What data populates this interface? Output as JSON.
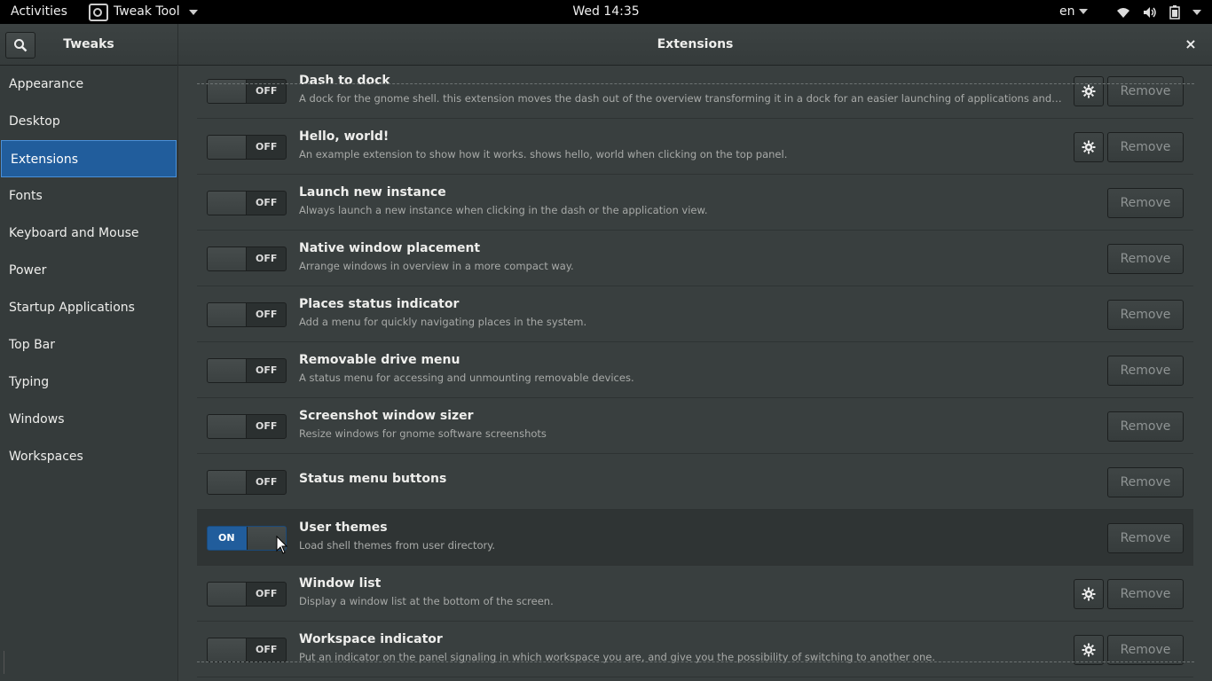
{
  "topbar": {
    "activities": "Activities",
    "app_name": "Tweak Tool",
    "clock": "Wed 14:35",
    "language": "en"
  },
  "header": {
    "sidebar_title": "Tweaks",
    "page_title": "Extensions",
    "close": "×"
  },
  "sidebar": {
    "items": [
      {
        "label": "Appearance"
      },
      {
        "label": "Desktop"
      },
      {
        "label": "Extensions",
        "active": true
      },
      {
        "label": "Fonts"
      },
      {
        "label": "Keyboard and Mouse"
      },
      {
        "label": "Power"
      },
      {
        "label": "Startup Applications"
      },
      {
        "label": "Top Bar"
      },
      {
        "label": "Typing"
      },
      {
        "label": "Windows"
      },
      {
        "label": "Workspaces"
      }
    ]
  },
  "extensions": [
    {
      "name": "Dash to dock",
      "desc": "A dock for the gnome shell. this extension moves the dash out of the overview transforming it in a dock for an easier launching of applications and a faster switching between windows and desktops.",
      "state": "OFF",
      "settings": true,
      "remove": "Remove"
    },
    {
      "name": "Hello, world!",
      "desc": "An example extension to show how it works. shows hello, world when clicking on the top panel.",
      "state": "OFF",
      "settings": true,
      "remove": "Remove"
    },
    {
      "name": "Launch new instance",
      "desc": "Always launch a new instance when clicking in the dash or the application view.",
      "state": "OFF",
      "settings": false,
      "remove": "Remove"
    },
    {
      "name": "Native window placement",
      "desc": "Arrange windows in overview in a more compact way.",
      "state": "OFF",
      "settings": false,
      "remove": "Remove"
    },
    {
      "name": "Places status indicator",
      "desc": "Add a menu for quickly navigating places in the system.",
      "state": "OFF",
      "settings": false,
      "remove": "Remove"
    },
    {
      "name": "Removable drive menu",
      "desc": "A status menu for accessing and unmounting removable devices.",
      "state": "OFF",
      "settings": false,
      "remove": "Remove"
    },
    {
      "name": "Screenshot window sizer",
      "desc": "Resize windows for gnome software screenshots",
      "state": "OFF",
      "settings": false,
      "remove": "Remove"
    },
    {
      "name": "Status menu buttons",
      "desc": "",
      "state": "OFF",
      "settings": false,
      "remove": "Remove"
    },
    {
      "name": "User themes",
      "desc": "Load shell themes from user directory.",
      "state": "ON",
      "settings": false,
      "remove": "Remove"
    },
    {
      "name": "Window list",
      "desc": "Display a window list at the bottom of the screen.",
      "state": "OFF",
      "settings": true,
      "remove": "Remove"
    },
    {
      "name": "Workspace indicator",
      "desc": "Put an indicator on the panel signaling in which workspace you are, and give you the possibility of switching to another one.",
      "state": "OFF",
      "settings": true,
      "remove": "Remove"
    }
  ]
}
